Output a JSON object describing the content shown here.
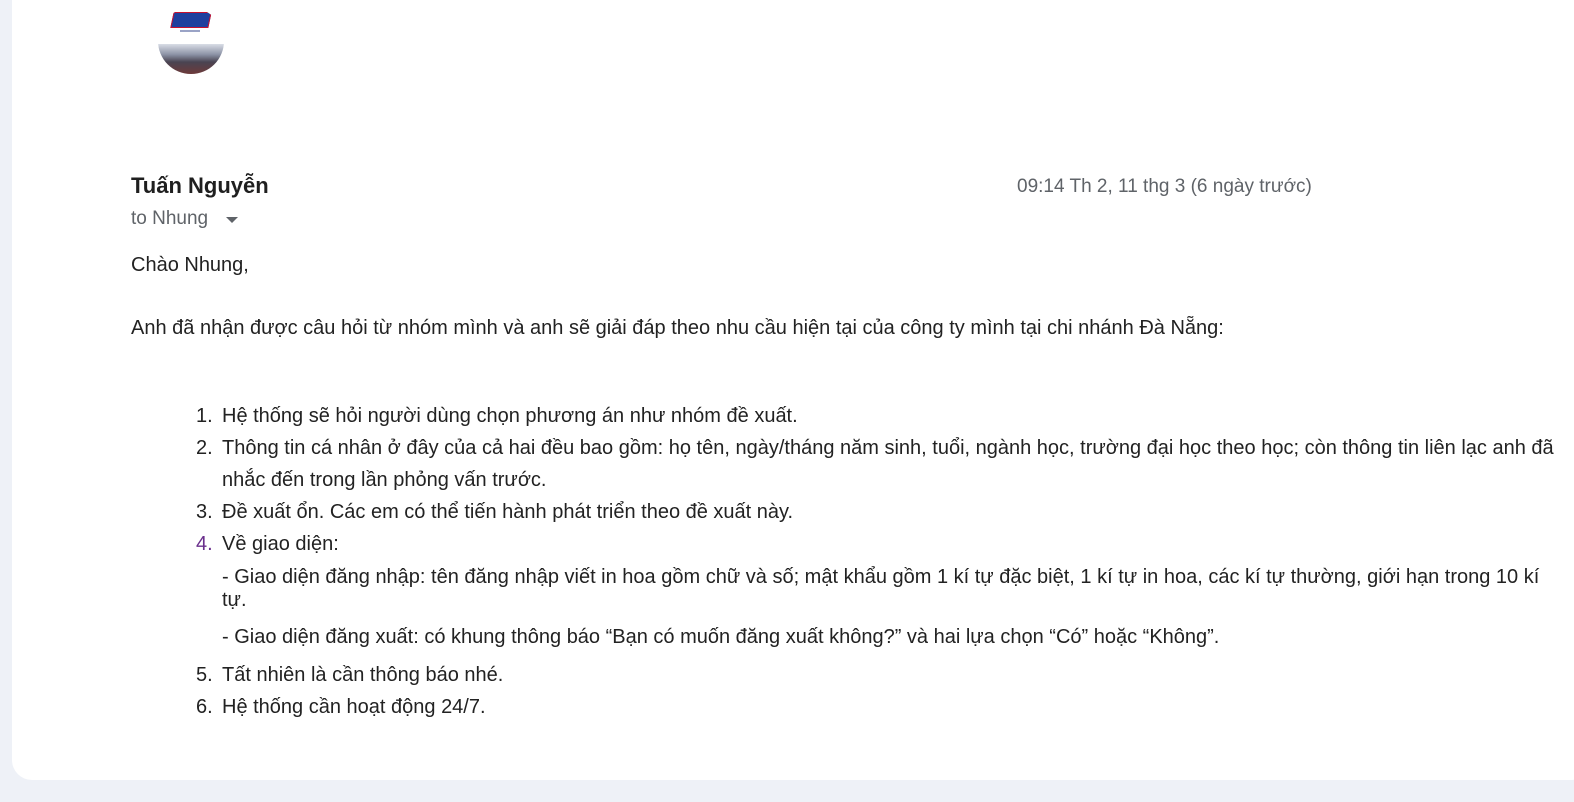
{
  "email": {
    "sender_name": "Tuấn Nguyễn",
    "timestamp": "09:14 Th 2, 11 thg 3 (6 ngày trước)",
    "recipient": "to Nhung",
    "greeting": "Chào Nhung,",
    "intro": "Anh đã nhận được câu hỏi từ nhóm mình và anh sẽ giải đáp theo nhu cầu hiện tại của công ty mình tại chi nhánh Đà Nẵng:",
    "items": [
      {
        "num": "1.",
        "text": "Hệ thống sẽ hỏi người dùng chọn phương án như nhóm đề xuất."
      },
      {
        "num": "2.",
        "text": "Thông tin cá nhân ở đây của cả hai đều bao gồm: họ tên, ngày/tháng năm sinh, tuổi, ngành học, trường đại học theo học; còn thông tin liên lạc anh đã nhắc đến trong lần phỏng vấn trước."
      },
      {
        "num": "3.",
        "text": "Đề xuất ổn. Các em có thể tiến hành phát triển theo đề xuất này."
      },
      {
        "num": "4.",
        "text": "Về giao diện:"
      },
      {
        "num": "5.",
        "text": "Tất nhiên là cần thông báo nhé."
      },
      {
        "num": "6.",
        "text": "Hệ thống cần hoạt động 24/7."
      }
    ],
    "subitems": [
      "- Giao diện đăng nhập: tên đăng nhập viết in hoa gồm chữ và số; mật khẩu gồm 1 kí tự đặc biệt, 1 kí tự in hoa, các kí tự thường, giới hạn trong 10 kí tự.",
      "- Giao diện đăng xuất: có khung thông báo “Bạn có muốn đăng xuất không?” và hai lựa chọn “Có” hoặc “Không”."
    ]
  },
  "colors": {
    "background": "#eef1f7",
    "card": "#ffffff",
    "text": "#222222",
    "muted": "#5f6368",
    "list_number_accent": "#6a2f8c"
  }
}
